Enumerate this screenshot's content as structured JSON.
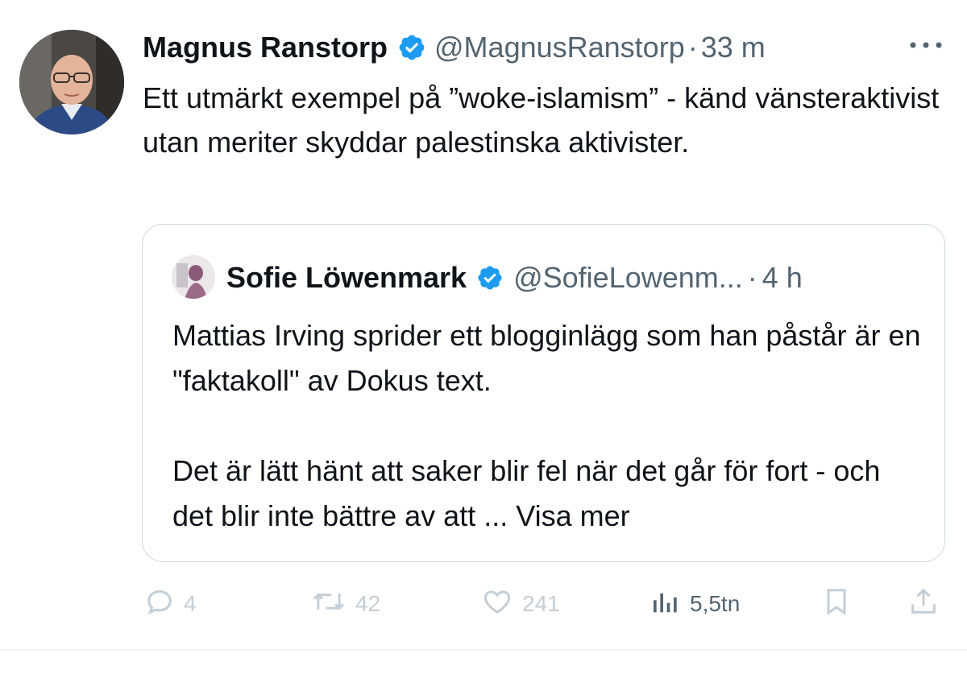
{
  "tweet": {
    "author_name": "Magnus Ranstorp",
    "handle": "@MagnusRanstorp",
    "separator": "·",
    "time": "33 m",
    "text": "Ett utmärkt exempel på ”woke-islamism” - känd vänsteraktivist utan meriter skyddar palestinska aktivister."
  },
  "quoted": {
    "author_name": "Sofie Löwenmark",
    "handle": "@SofieLowenm...",
    "separator": "·",
    "time": "4 h",
    "para1": "Mattias Irving sprider ett blogginlägg som han påstår är en \"faktakoll\" av Dokus text.",
    "para2_text": "Det är lätt hänt att saker blir fel när det går för fort - och det blir inte bättre av att ... ",
    "more_label": "Visa mer"
  },
  "actions": {
    "replies": "4",
    "retweets": "42",
    "likes": "241",
    "views": "5,5tn"
  },
  "icons": {
    "verified": "verified-badge-icon",
    "more": "more-options-icon",
    "reply": "reply-icon",
    "retweet": "retweet-icon",
    "like": "heart-icon",
    "views": "views-icon",
    "bookmark": "bookmark-icon",
    "share": "share-icon"
  },
  "colors": {
    "verified_blue": "#1d9bf0",
    "text_primary": "#0f1419",
    "text_secondary": "#536471",
    "action_faded": "#c4ced6",
    "border": "#cfd9de"
  }
}
